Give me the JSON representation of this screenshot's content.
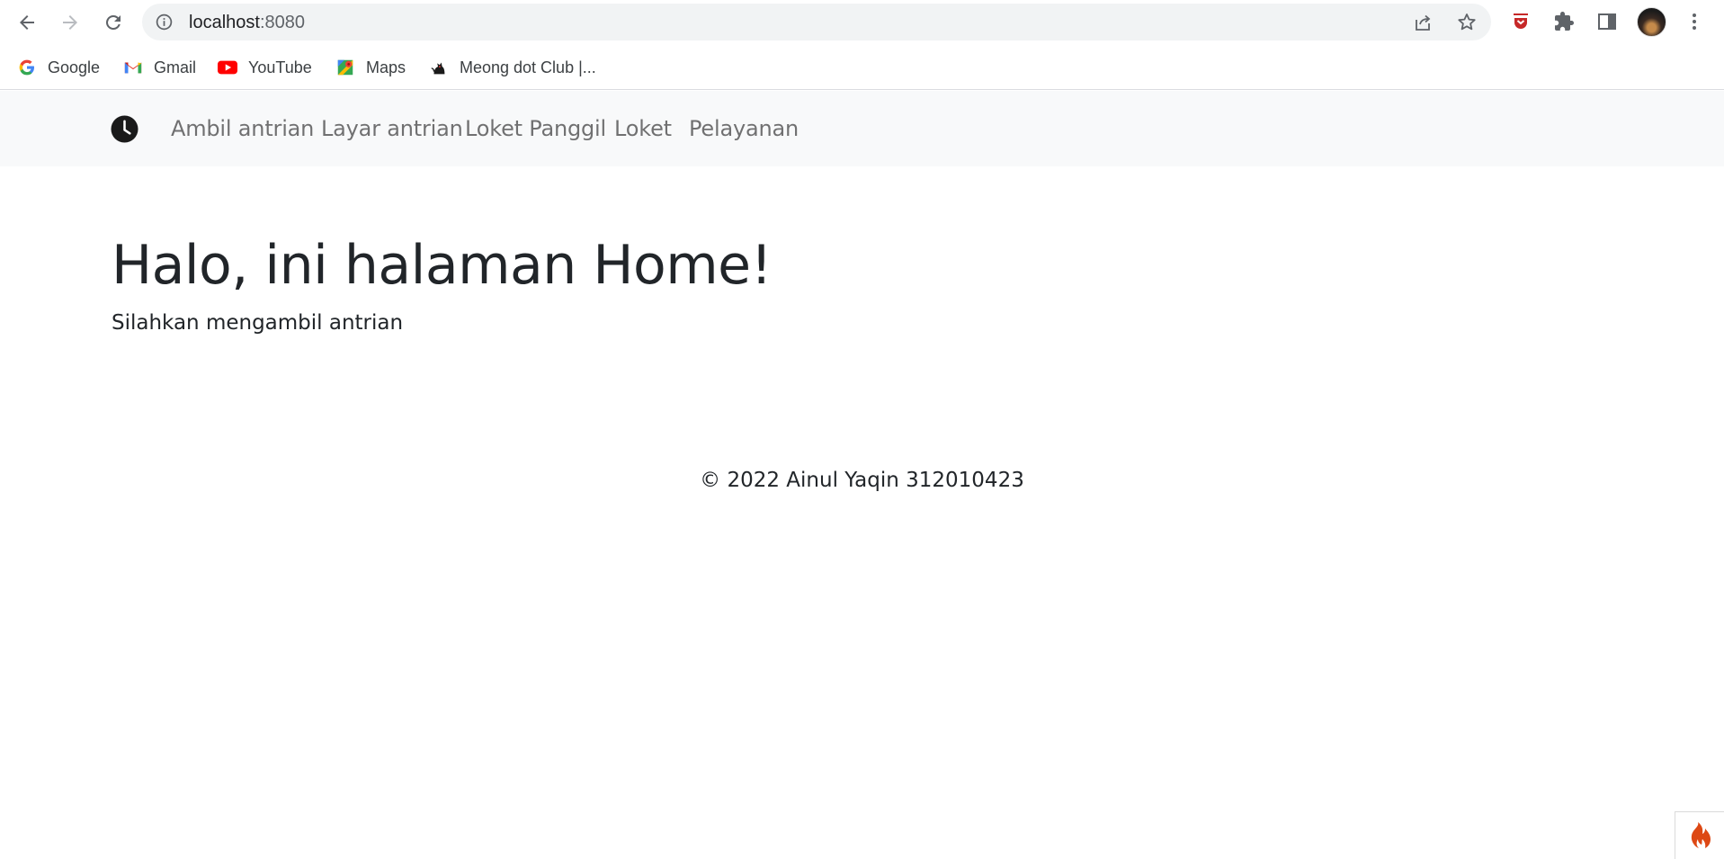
{
  "browser": {
    "url_host": "localhost",
    "url_port": ":8080",
    "bookmarks": [
      {
        "label": "Google",
        "icon": "google-icon"
      },
      {
        "label": "Gmail",
        "icon": "gmail-icon"
      },
      {
        "label": "YouTube",
        "icon": "youtube-icon"
      },
      {
        "label": "Maps",
        "icon": "maps-icon"
      },
      {
        "label": "Meong dot Club |...",
        "icon": "cat-icon"
      }
    ]
  },
  "navbar": {
    "brand_icon": "clock-icon",
    "links": [
      {
        "label": "Ambil antrian"
      },
      {
        "label": "Layar antrian"
      },
      {
        "label": "Loket Panggil"
      },
      {
        "label": "Loket"
      },
      {
        "label": "Pelayanan"
      }
    ]
  },
  "main": {
    "title": "Halo, ini halaman Home!",
    "lead": "Silahkan mengambil antrian"
  },
  "footer": {
    "text": "© 2022 Ainul Yaqin 312010423"
  },
  "colors": {
    "navbar_bg": "#f8f9fa",
    "text": "#212529",
    "nav_link": "rgba(0,0,0,0.55)",
    "codeigniter_flame": "#dd4814"
  }
}
